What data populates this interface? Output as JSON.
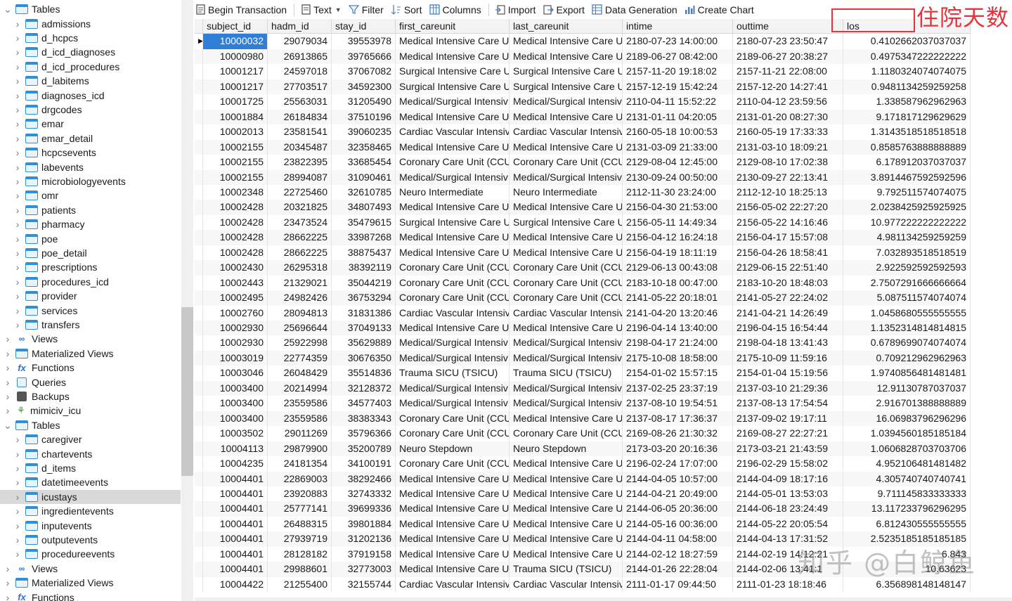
{
  "sidebar": {
    "items": [
      {
        "label": "Tables",
        "kind": "folder",
        "expanded": true,
        "indent": 0,
        "icon": "table-icon"
      },
      {
        "label": "admissions",
        "kind": "table",
        "indent": 1,
        "icon": "table-icon"
      },
      {
        "label": "d_hcpcs",
        "kind": "table",
        "indent": 1,
        "icon": "table-icon"
      },
      {
        "label": "d_icd_diagnoses",
        "kind": "table",
        "indent": 1,
        "icon": "table-icon"
      },
      {
        "label": "d_icd_procedures",
        "kind": "table",
        "indent": 1,
        "icon": "table-icon"
      },
      {
        "label": "d_labitems",
        "kind": "table",
        "indent": 1,
        "icon": "table-icon"
      },
      {
        "label": "diagnoses_icd",
        "kind": "table",
        "indent": 1,
        "icon": "table-icon"
      },
      {
        "label": "drgcodes",
        "kind": "table",
        "indent": 1,
        "icon": "table-icon"
      },
      {
        "label": "emar",
        "kind": "table",
        "indent": 1,
        "icon": "table-icon"
      },
      {
        "label": "emar_detail",
        "kind": "table",
        "indent": 1,
        "icon": "table-icon"
      },
      {
        "label": "hcpcsevents",
        "kind": "table",
        "indent": 1,
        "icon": "table-icon"
      },
      {
        "label": "labevents",
        "kind": "table",
        "indent": 1,
        "icon": "table-icon"
      },
      {
        "label": "microbiologyevents",
        "kind": "table",
        "indent": 1,
        "icon": "table-icon"
      },
      {
        "label": "omr",
        "kind": "table",
        "indent": 1,
        "icon": "table-icon"
      },
      {
        "label": "patients",
        "kind": "table",
        "indent": 1,
        "icon": "table-icon"
      },
      {
        "label": "pharmacy",
        "kind": "table",
        "indent": 1,
        "icon": "table-icon"
      },
      {
        "label": "poe",
        "kind": "table",
        "indent": 1,
        "icon": "table-icon"
      },
      {
        "label": "poe_detail",
        "kind": "table",
        "indent": 1,
        "icon": "table-icon"
      },
      {
        "label": "prescriptions",
        "kind": "table",
        "indent": 1,
        "icon": "table-icon"
      },
      {
        "label": "procedures_icd",
        "kind": "table",
        "indent": 1,
        "icon": "table-icon"
      },
      {
        "label": "provider",
        "kind": "table",
        "indent": 1,
        "icon": "table-icon"
      },
      {
        "label": "services",
        "kind": "table",
        "indent": 1,
        "icon": "table-icon"
      },
      {
        "label": "transfers",
        "kind": "table",
        "indent": 1,
        "icon": "table-icon"
      },
      {
        "label": "Views",
        "kind": "views",
        "indent": 0,
        "icon": "views-icon"
      },
      {
        "label": "Materialized Views",
        "kind": "table",
        "indent": 0,
        "icon": "table-icon"
      },
      {
        "label": "Functions",
        "kind": "fx",
        "indent": 0,
        "icon": "function-icon"
      },
      {
        "label": "Queries",
        "kind": "query",
        "indent": 0,
        "icon": "query-icon"
      },
      {
        "label": "Backups",
        "kind": "backup",
        "indent": 0,
        "icon": "backup-icon"
      },
      {
        "label": "mimiciv_icu",
        "kind": "schema",
        "indent": -1,
        "icon": "schema-icon"
      },
      {
        "label": "Tables",
        "kind": "folder",
        "expanded": true,
        "indent": 0,
        "icon": "table-icon"
      },
      {
        "label": "caregiver",
        "kind": "table",
        "indent": 1,
        "icon": "table-icon"
      },
      {
        "label": "chartevents",
        "kind": "table",
        "indent": 1,
        "icon": "table-icon"
      },
      {
        "label": "d_items",
        "kind": "table",
        "indent": 1,
        "icon": "table-icon"
      },
      {
        "label": "datetimeevents",
        "kind": "table",
        "indent": 1,
        "icon": "table-icon"
      },
      {
        "label": "icustays",
        "kind": "table",
        "indent": 1,
        "icon": "table-icon",
        "selected": true
      },
      {
        "label": "ingredientevents",
        "kind": "table",
        "indent": 1,
        "icon": "table-icon"
      },
      {
        "label": "inputevents",
        "kind": "table",
        "indent": 1,
        "icon": "table-icon"
      },
      {
        "label": "outputevents",
        "kind": "table",
        "indent": 1,
        "icon": "table-icon"
      },
      {
        "label": "procedureevents",
        "kind": "table",
        "indent": 1,
        "icon": "table-icon"
      },
      {
        "label": "Views",
        "kind": "views",
        "indent": 0,
        "icon": "views-icon"
      },
      {
        "label": "Materialized Views",
        "kind": "table",
        "indent": 0,
        "icon": "table-icon"
      },
      {
        "label": "Functions",
        "kind": "fx",
        "indent": 0,
        "icon": "function-icon"
      }
    ]
  },
  "toolbar": {
    "begin_transaction": "Begin Transaction",
    "text": "Text",
    "filter": "Filter",
    "sort": "Sort",
    "columns": "Columns",
    "import": "Import",
    "export": "Export",
    "data_generation": "Data Generation",
    "create_chart": "Create Chart"
  },
  "grid": {
    "columns": [
      "subject_id",
      "hadm_id",
      "stay_id",
      "first_careunit",
      "last_careunit",
      "intime",
      "outtime",
      "los"
    ],
    "rows": [
      [
        "10000032",
        "29079034",
        "39553978",
        "Medical Intensive Care U",
        "Medical Intensive Care U",
        "2180-07-23 14:00:00",
        "2180-07-23 23:50:47",
        "0.4102662037037037"
      ],
      [
        "10000980",
        "26913865",
        "39765666",
        "Medical Intensive Care U",
        "Medical Intensive Care U",
        "2189-06-27 08:42:00",
        "2189-06-27 20:38:27",
        "0.4975347222222222"
      ],
      [
        "10001217",
        "24597018",
        "37067082",
        "Surgical Intensive Care U",
        "Surgical Intensive Care U",
        "2157-11-20 19:18:02",
        "2157-11-21 22:08:00",
        "1.1180324074074075"
      ],
      [
        "10001217",
        "27703517",
        "34592300",
        "Surgical Intensive Care U",
        "Surgical Intensive Care U",
        "2157-12-19 15:42:24",
        "2157-12-20 14:27:41",
        "0.9481134259259258"
      ],
      [
        "10001725",
        "25563031",
        "31205490",
        "Medical/Surgical Intensiv",
        "Medical/Surgical Intensiv",
        "2110-04-11 15:52:22",
        "2110-04-12 23:59:56",
        "1.338587962962963"
      ],
      [
        "10001884",
        "26184834",
        "37510196",
        "Medical Intensive Care U",
        "Medical Intensive Care U",
        "2131-01-11 04:20:05",
        "2131-01-20 08:27:30",
        "9.171817129629629"
      ],
      [
        "10002013",
        "23581541",
        "39060235",
        "Cardiac Vascular Intensiv",
        "Cardiac Vascular Intensiv",
        "2160-05-18 10:00:53",
        "2160-05-19 17:33:33",
        "1.3143518518518518"
      ],
      [
        "10002155",
        "20345487",
        "32358465",
        "Medical Intensive Care U",
        "Medical Intensive Care U",
        "2131-03-09 21:33:00",
        "2131-03-10 18:09:21",
        "0.8585763888888889"
      ],
      [
        "10002155",
        "23822395",
        "33685454",
        "Coronary Care Unit (CCU",
        "Coronary Care Unit (CCU",
        "2129-08-04 12:45:00",
        "2129-08-10 17:02:38",
        "6.178912037037037"
      ],
      [
        "10002155",
        "28994087",
        "31090461",
        "Medical/Surgical Intensiv",
        "Medical/Surgical Intensiv",
        "2130-09-24 00:50:00",
        "2130-09-27 22:13:41",
        "3.8914467592592596"
      ],
      [
        "10002348",
        "22725460",
        "32610785",
        "Neuro Intermediate",
        "Neuro Intermediate",
        "2112-11-30 23:24:00",
        "2112-12-10 18:25:13",
        "9.792511574074075"
      ],
      [
        "10002428",
        "20321825",
        "34807493",
        "Medical Intensive Care U",
        "Medical Intensive Care U",
        "2156-04-30 21:53:00",
        "2156-05-02 22:27:20",
        "2.0238425925925925"
      ],
      [
        "10002428",
        "23473524",
        "35479615",
        "Surgical Intensive Care U",
        "Surgical Intensive Care U",
        "2156-05-11 14:49:34",
        "2156-05-22 14:16:46",
        "10.977222222222222"
      ],
      [
        "10002428",
        "28662225",
        "33987268",
        "Medical Intensive Care U",
        "Medical Intensive Care U",
        "2156-04-12 16:24:18",
        "2156-04-17 15:57:08",
        "4.981134259259259"
      ],
      [
        "10002428",
        "28662225",
        "38875437",
        "Medical Intensive Care U",
        "Medical Intensive Care U",
        "2156-04-19 18:11:19",
        "2156-04-26 18:58:41",
        "7.032893518518519"
      ],
      [
        "10002430",
        "26295318",
        "38392119",
        "Coronary Care Unit (CCU",
        "Coronary Care Unit (CCU",
        "2129-06-13 00:43:08",
        "2129-06-15 22:51:40",
        "2.922592592592593"
      ],
      [
        "10002443",
        "21329021",
        "35044219",
        "Coronary Care Unit (CCU",
        "Coronary Care Unit (CCU",
        "2183-10-18 00:47:00",
        "2183-10-20 18:48:03",
        "2.7507291666666664"
      ],
      [
        "10002495",
        "24982426",
        "36753294",
        "Coronary Care Unit (CCU",
        "Coronary Care Unit (CCU",
        "2141-05-22 20:18:01",
        "2141-05-27 22:24:02",
        "5.087511574074074"
      ],
      [
        "10002760",
        "28094813",
        "31831386",
        "Cardiac Vascular Intensiv",
        "Cardiac Vascular Intensiv",
        "2141-04-20 13:20:46",
        "2141-04-21 14:26:49",
        "1.0458680555555555"
      ],
      [
        "10002930",
        "25696644",
        "37049133",
        "Medical Intensive Care U",
        "Medical Intensive Care U",
        "2196-04-14 13:40:00",
        "2196-04-15 16:54:44",
        "1.1352314814814815"
      ],
      [
        "10002930",
        "25922998",
        "35629889",
        "Medical/Surgical Intensiv",
        "Medical/Surgical Intensiv",
        "2198-04-17 21:24:00",
        "2198-04-18 13:41:43",
        "0.6789699074074074"
      ],
      [
        "10003019",
        "22774359",
        "30676350",
        "Medical/Surgical Intensiv",
        "Medical/Surgical Intensiv",
        "2175-10-08 18:58:00",
        "2175-10-09 11:59:16",
        "0.709212962962963"
      ],
      [
        "10003046",
        "26048429",
        "35514836",
        "Trauma SICU (TSICU)",
        "Trauma SICU (TSICU)",
        "2154-01-02 15:57:15",
        "2154-01-04 15:19:56",
        "1.9740856481481481"
      ],
      [
        "10003400",
        "20214994",
        "32128372",
        "Medical/Surgical Intensiv",
        "Medical/Surgical Intensiv",
        "2137-02-25 23:37:19",
        "2137-03-10 21:29:36",
        "12.91130787037037"
      ],
      [
        "10003400",
        "23559586",
        "34577403",
        "Medical/Surgical Intensiv",
        "Medical/Surgical Intensiv",
        "2137-08-10 19:54:51",
        "2137-08-13 17:54:54",
        "2.916701388888889"
      ],
      [
        "10003400",
        "23559586",
        "38383343",
        "Coronary Care Unit (CCU",
        "Medical Intensive Care U",
        "2137-08-17 17:36:37",
        "2137-09-02 19:17:11",
        "16.06983796296296"
      ],
      [
        "10003502",
        "29011269",
        "35796366",
        "Coronary Care Unit (CCU",
        "Coronary Care Unit (CCU",
        "2169-08-26 21:30:32",
        "2169-08-27 22:27:21",
        "1.0394560185185184"
      ],
      [
        "10004113",
        "29879900",
        "35200789",
        "Neuro Stepdown",
        "Neuro Stepdown",
        "2173-03-20 20:16:36",
        "2173-03-21 21:43:59",
        "1.0606828703703706"
      ],
      [
        "10004235",
        "24181354",
        "34100191",
        "Coronary Care Unit (CCU",
        "Medical Intensive Care U",
        "2196-02-24 17:07:00",
        "2196-02-29 15:58:02",
        "4.952106481481482"
      ],
      [
        "10004401",
        "22869003",
        "38292466",
        "Medical Intensive Care U",
        "Medical Intensive Care U",
        "2144-04-05 10:57:00",
        "2144-04-09 18:17:16",
        "4.305740740740741"
      ],
      [
        "10004401",
        "23920883",
        "32743332",
        "Medical Intensive Care U",
        "Medical Intensive Care U",
        "2144-04-21 20:49:00",
        "2144-05-01 13:53:03",
        "9.711145833333333"
      ],
      [
        "10004401",
        "25777141",
        "39699336",
        "Medical Intensive Care U",
        "Medical Intensive Care U",
        "2144-06-05 20:36:00",
        "2144-06-18 23:24:49",
        "13.117233796296295"
      ],
      [
        "10004401",
        "26488315",
        "39801884",
        "Medical Intensive Care U",
        "Medical Intensive Care U",
        "2144-05-16 00:36:00",
        "2144-05-22 20:05:54",
        "6.812430555555555"
      ],
      [
        "10004401",
        "27939719",
        "31202136",
        "Medical Intensive Care U",
        "Medical Intensive Care U",
        "2144-04-11 04:58:00",
        "2144-04-13 17:31:52",
        "2.5235185185185185"
      ],
      [
        "10004401",
        "28128182",
        "37919158",
        "Medical Intensive Care U",
        "Medical Intensive Care U",
        "2144-02-12 18:27:59",
        "2144-02-19 14:12:21",
        "6.843"
      ],
      [
        "10004401",
        "29988601",
        "32773003",
        "Medical Intensive Care U",
        "Trauma SICU (TSICU)",
        "2144-01-26 22:28:04",
        "2144-02-06 13:41:1",
        "10.63623"
      ],
      [
        "10004422",
        "21255400",
        "32155744",
        "Cardiac Vascular Intensiv",
        "Cardiac Vascular Intensiv",
        "2111-01-17 09:44:50",
        "2111-01-23 18:18:46",
        "6.356898148148147"
      ]
    ]
  },
  "annotation": {
    "text": "住院天数",
    "color": "#e8333a"
  },
  "watermark": {
    "text": "知乎 @白鲸鱼"
  },
  "colors": {
    "selected_cell": "#2f7fd8",
    "sidebar_selected": "#d9d9d9",
    "icon_blue": "#2f8fd8"
  }
}
